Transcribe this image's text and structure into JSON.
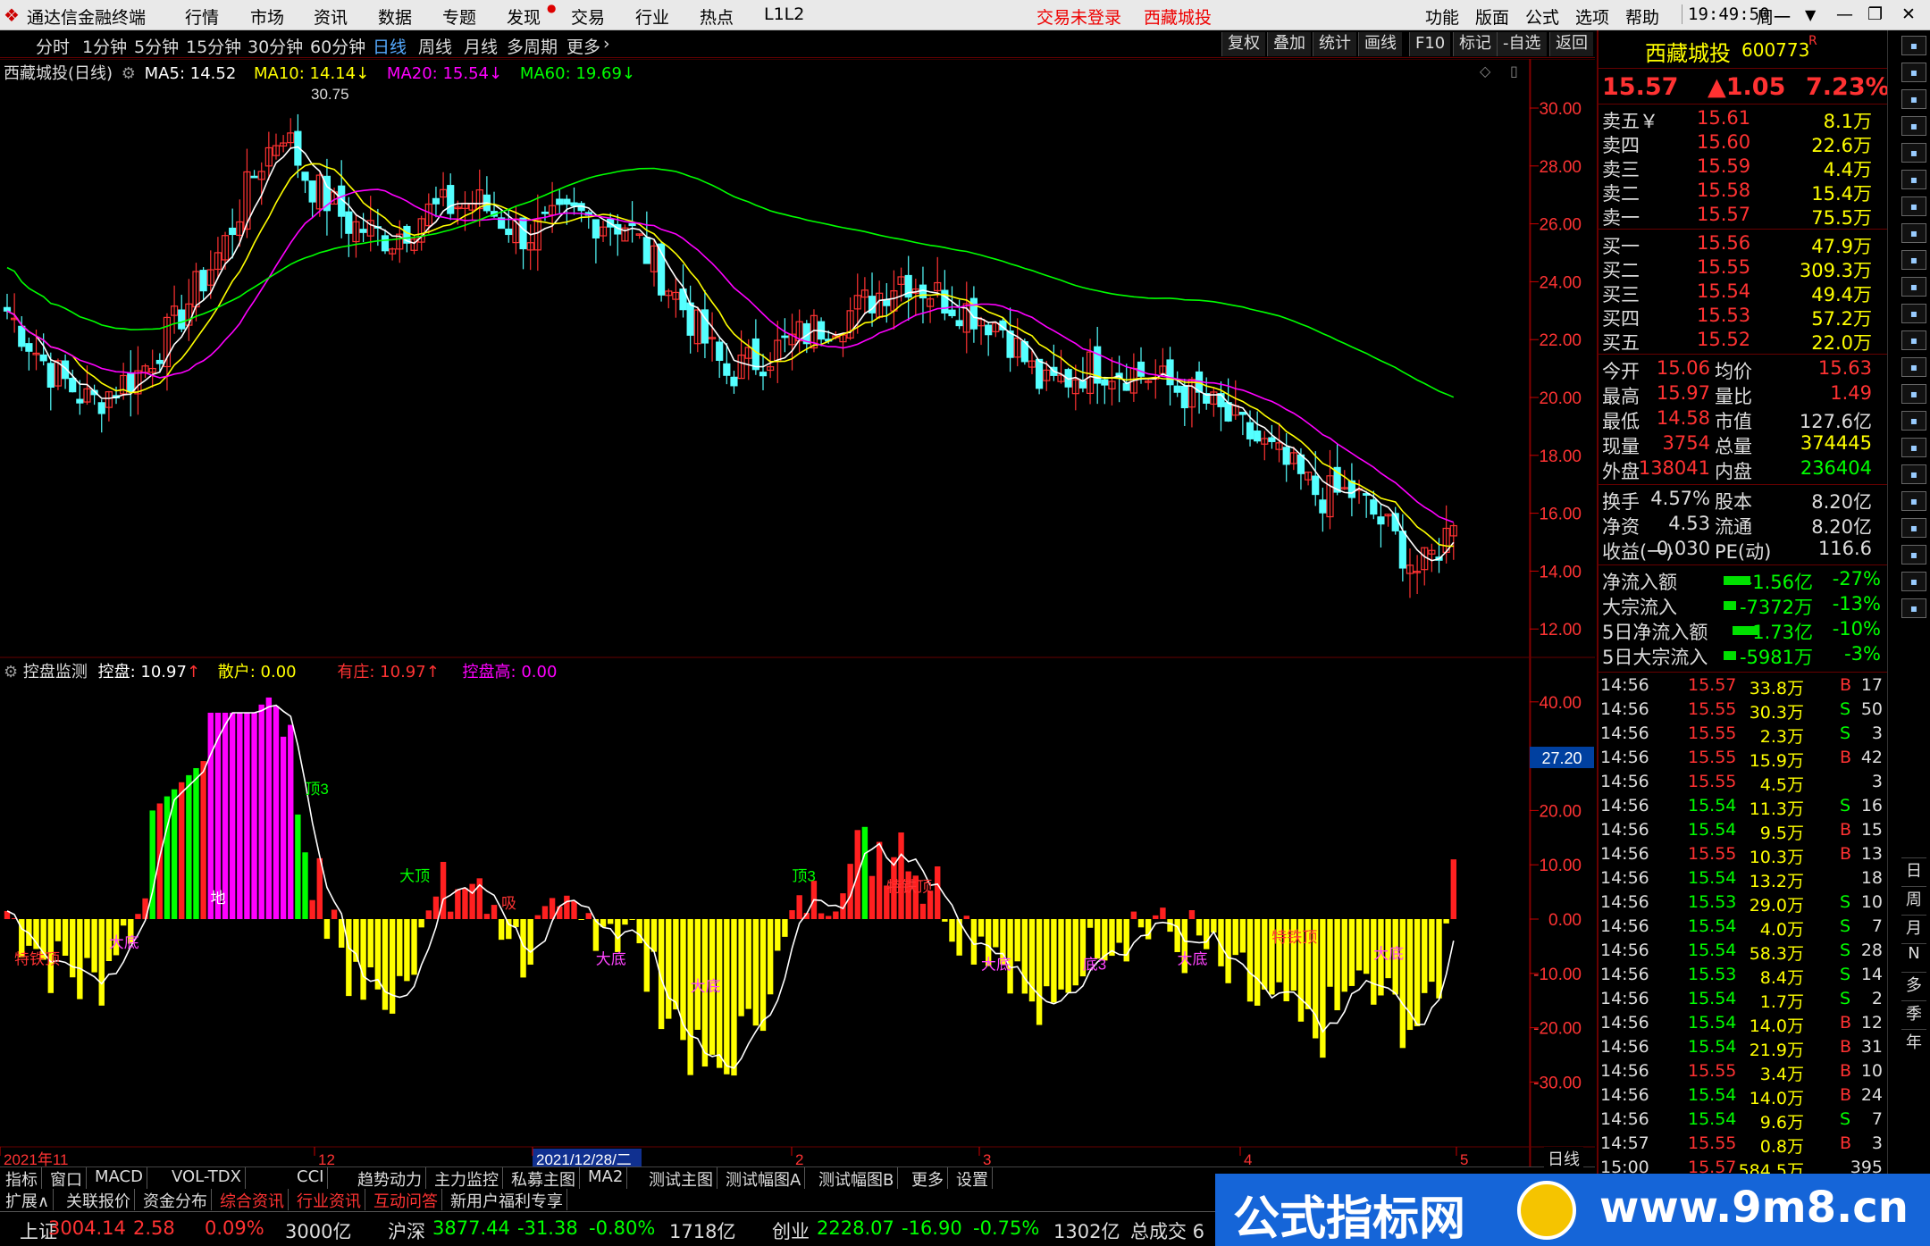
{
  "menubar": {
    "app_title": "通达信金融终端",
    "items": [
      "行情",
      "市场",
      "资讯",
      "数据",
      "专题",
      "发现",
      "交易",
      "行业",
      "热点",
      "L1L2"
    ],
    "status_login": "交易未登录",
    "status_stock": "西藏城投",
    "right_items": [
      "功能",
      "版面",
      "公式",
      "选项",
      "帮助"
    ],
    "time": "19:49:50",
    "weekday": "周一"
  },
  "toolbar": {
    "periods": [
      "分时",
      "1分钟",
      "5分钟",
      "15分钟",
      "30分钟",
      "60分钟",
      "日线",
      "周线",
      "月线",
      "多周期",
      "更多"
    ],
    "selected": "日线",
    "right_buttons": [
      "复权",
      "叠加",
      "统计",
      "画线",
      "F10",
      "标记",
      "-自选",
      "返回"
    ]
  },
  "kline": {
    "title": "西藏城投(日线)",
    "ma": [
      {
        "label": "MA5: 14.52",
        "color": "#ffffff"
      },
      {
        "label": "MA10: 14.14",
        "color": "#ffff00"
      },
      {
        "label": "MA20: 15.54",
        "color": "#ff00ff"
      },
      {
        "label": "MA60: 19.69",
        "color": "#00ff00"
      }
    ],
    "high_label": "30.75",
    "yticks": [
      "30.00",
      "28.00",
      "26.00",
      "24.00",
      "22.00",
      "20.00",
      "18.00",
      "16.00",
      "14.00",
      "12.00"
    ]
  },
  "indicator": {
    "name": "控盘监测",
    "items": [
      {
        "label": "控盘: 10.97",
        "color": "#ffffff"
      },
      {
        "label": "散户: 0.00",
        "color": "#ffff00"
      },
      {
        "label": "有庄: 10.97",
        "color": "#ff3333"
      },
      {
        "label": "控盘高: 0.00",
        "color": "#ff00ff"
      }
    ],
    "yticks": [
      "40.00",
      "30.00",
      "20.00",
      "10.00",
      "0.00",
      "-10.00",
      "-20.00",
      "-30.00"
    ],
    "current": "27.20",
    "labels": [
      {
        "t": "特铁顶",
        "c": "#ff3333"
      },
      {
        "t": "大底",
        "c": "#ff44ff"
      },
      {
        "t": "地",
        "c": "#ffffff"
      },
      {
        "t": "顶3",
        "c": "#00ff00"
      },
      {
        "t": "大顶",
        "c": "#00ff00"
      },
      {
        "t": "吸",
        "c": "#ff3333"
      },
      {
        "t": "大底",
        "c": "#ff44ff"
      },
      {
        "t": "大底",
        "c": "#ff44ff"
      },
      {
        "t": "顶3",
        "c": "#00ff00"
      },
      {
        "t": "特铁顶",
        "c": "#ff3333"
      },
      {
        "t": "大底",
        "c": "#ff44ff"
      },
      {
        "t": "底3",
        "c": "#ff44ff"
      },
      {
        "t": "大底",
        "c": "#ff44ff"
      },
      {
        "t": "特铁顶",
        "c": "#ff3333"
      },
      {
        "t": "大底",
        "c": "#ff44ff"
      }
    ]
  },
  "dates": [
    "2021年11",
    "12",
    "2021/12/28/二",
    "2",
    "3",
    "4",
    "5"
  ],
  "period_tag": "日线",
  "bottom_tabs": [
    "指标",
    "窗口",
    "MACD",
    "VOL-TDX",
    "CCI",
    "趋势动力",
    "主力监控",
    "私募主图",
    "MA2",
    "测试主图",
    "测试幅图A",
    "测试幅图B",
    "更多",
    "设置"
  ],
  "bottom_tabs2": [
    "扩展∧",
    "关联报价",
    "资金分布",
    "综合资讯",
    "行业资讯",
    "互动问答",
    "新用户福利专享"
  ],
  "quote": {
    "name": "西藏城投",
    "code": "600773",
    "flag": "R",
    "price": "15.57",
    "change": "▲1.05",
    "pct": "7.23%",
    "asks": [
      {
        "l": "卖五￥",
        "p": "15.61",
        "v": "8.1万"
      },
      {
        "l": "卖四",
        "p": "15.60",
        "v": "22.6万"
      },
      {
        "l": "卖三",
        "p": "15.59",
        "v": "4.4万"
      },
      {
        "l": "卖二",
        "p": "15.58",
        "v": "15.4万"
      },
      {
        "l": "卖一",
        "p": "15.57",
        "v": "75.5万"
      }
    ],
    "bids": [
      {
        "l": "买一",
        "p": "15.56",
        "v": "47.9万"
      },
      {
        "l": "买二",
        "p": "15.55",
        "v": "309.3万"
      },
      {
        "l": "买三",
        "p": "15.54",
        "v": "49.4万"
      },
      {
        "l": "买四",
        "p": "15.53",
        "v": "57.2万"
      },
      {
        "l": "买五",
        "p": "15.52",
        "v": "22.0万"
      }
    ],
    "stats": [
      [
        "今开",
        "15.06",
        "均价",
        "15.63"
      ],
      [
        "最高",
        "15.97",
        "量比",
        "1.49"
      ],
      [
        "最低",
        "14.58",
        "市值",
        "127.6亿"
      ],
      [
        "现量",
        "3754",
        "总量",
        "374445"
      ],
      [
        "外盘",
        "138041",
        "内盘",
        "236404"
      ]
    ],
    "stats2": [
      [
        "换手",
        "4.57%",
        "股本",
        "8.20亿"
      ],
      [
        "净资",
        "4.53",
        "流通",
        "8.20亿"
      ],
      [
        "收益(一)",
        "0.030",
        "PE(动)",
        "116.6"
      ]
    ],
    "flows": [
      {
        "l": "净流入额",
        "v": "-1.56亿",
        "p": "-27%"
      },
      {
        "l": "大宗流入",
        "v": "-7372万",
        "p": "-13%"
      },
      {
        "l": "5日净流入额",
        "v": "-1.73亿",
        "p": "-10%"
      },
      {
        "l": "5日大宗流入",
        "v": "-5981万",
        "p": "-3%"
      }
    ]
  },
  "ticks": [
    [
      "14:56",
      "15.57",
      "33.8万",
      "B",
      "17"
    ],
    [
      "14:56",
      "15.55",
      "30.3万",
      "S",
      "50"
    ],
    [
      "14:56",
      "15.55",
      "2.3万",
      "S",
      "3"
    ],
    [
      "14:56",
      "15.55",
      "15.9万",
      "B",
      "42"
    ],
    [
      "14:56",
      "15.55",
      "4.5万",
      "",
      "3"
    ],
    [
      "14:56",
      "15.54",
      "11.3万",
      "S",
      "16"
    ],
    [
      "14:56",
      "15.54",
      "9.5万",
      "B",
      "15"
    ],
    [
      "14:56",
      "15.55",
      "10.3万",
      "B",
      "13"
    ],
    [
      "14:56",
      "15.54",
      "13.2万",
      "",
      "18"
    ],
    [
      "14:56",
      "15.53",
      "29.0万",
      "S",
      "10"
    ],
    [
      "14:56",
      "15.54",
      "4.0万",
      "S",
      "7"
    ],
    [
      "14:56",
      "15.54",
      "58.3万",
      "S",
      "28"
    ],
    [
      "14:56",
      "15.53",
      "8.4万",
      "S",
      "14"
    ],
    [
      "14:56",
      "15.54",
      "1.7万",
      "S",
      "2"
    ],
    [
      "14:56",
      "15.54",
      "14.0万",
      "B",
      "12"
    ],
    [
      "14:56",
      "15.54",
      "21.9万",
      "B",
      "31"
    ],
    [
      "14:56",
      "15.55",
      "3.4万",
      "B",
      "10"
    ],
    [
      "14:56",
      "15.54",
      "14.0万",
      "B",
      "24"
    ],
    [
      "14:56",
      "15.54",
      "9.6万",
      "S",
      "7"
    ],
    [
      "14:57",
      "15.55",
      "0.8万",
      "B",
      "3"
    ],
    [
      "15:00",
      "15.57",
      "584.5万",
      "",
      "395"
    ]
  ],
  "side_labels": [
    "日",
    "周",
    "月",
    "N",
    "多",
    "季",
    "年"
  ],
  "status_bar": [
    {
      "n": "上证",
      "v": "3004.14",
      "c": "2.58",
      "p": "0.09%",
      "a": "3000亿"
    },
    {
      "n": "沪深",
      "v": "3877.44",
      "c": "-31.38",
      "p": "-0.80%",
      "a": "1718亿"
    },
    {
      "n": "创业",
      "v": "2228.07",
      "c": "-16.90",
      "p": "-0.75%",
      "a": "1302亿"
    }
  ],
  "status_tail": "总成交 6",
  "watermark": {
    "text": "公式指标网",
    "url": "www.9m8.cn"
  },
  "colors": {
    "up": "#ff3232",
    "down": "#54ffff",
    "ma5": "#ffffff",
    "ma10": "#ffff00",
    "ma20": "#ff00ff",
    "ma60": "#00ff00"
  }
}
